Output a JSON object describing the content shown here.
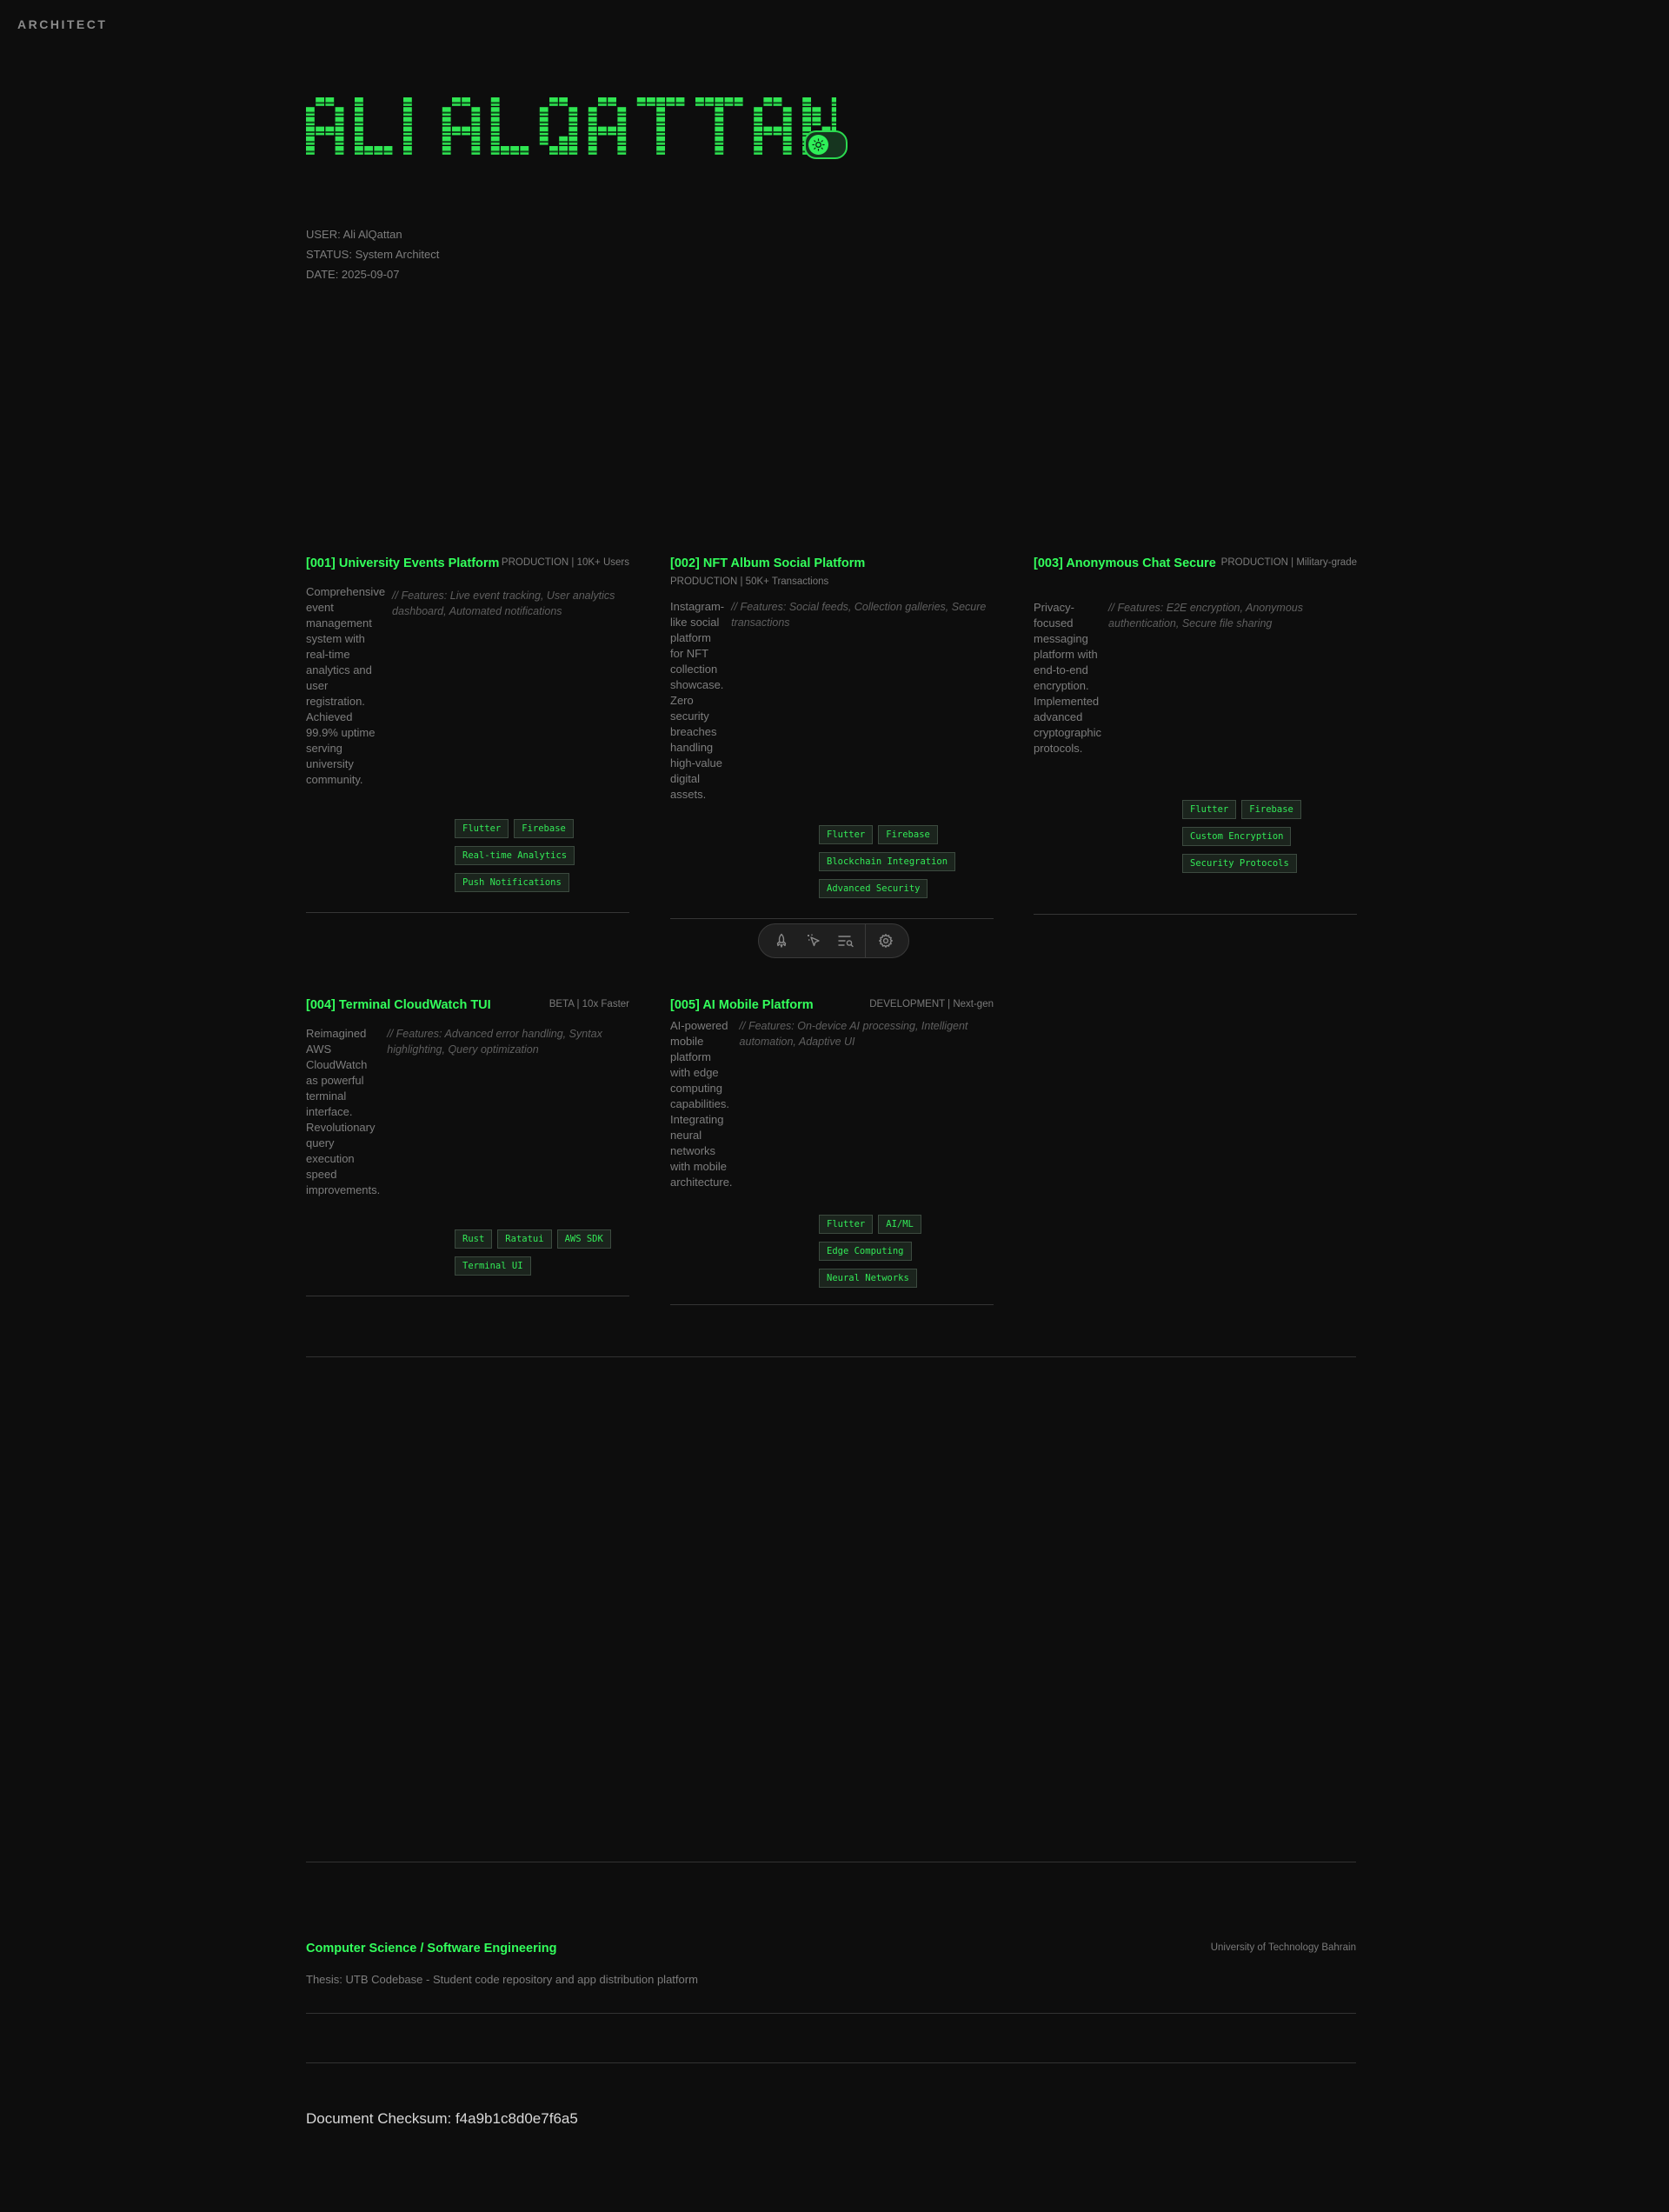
{
  "corner_label": "ARCHITECT",
  "hero": {
    "name": "ALI ALQATTAN"
  },
  "theme_toggle": {
    "icon": "sun-icon"
  },
  "meta": {
    "user": "USER: Ali AlQattan",
    "status": "STATUS: System Architect",
    "date": "DATE: 2025-09-07"
  },
  "projects": [
    {
      "title": "[001] University Events Platform",
      "status": "PRODUCTION | 10K+ Users",
      "desc_lines": [
        "Comprehensive",
        "event",
        "management",
        "system with",
        "real-time",
        "analytics and",
        "user",
        "registration.",
        "Achieved",
        "99.9% uptime",
        "serving",
        "university",
        "community."
      ],
      "features_lines": [
        "// Features: Live event tracking, User analytics",
        "dashboard, Automated notifications"
      ],
      "tags": [
        [
          "Flutter",
          "Firebase"
        ],
        [
          "Real-time Analytics"
        ],
        [
          "Push Notifications"
        ]
      ]
    },
    {
      "title": "[002] NFT Album Social Platform",
      "status": "PRODUCTION | 50K+ Transactions",
      "desc_lines": [
        "Instagram-",
        "like social",
        "platform",
        "for NFT",
        "collection",
        "showcase.",
        "Zero",
        "security",
        "breaches",
        "handling",
        "high-value",
        "digital",
        "assets."
      ],
      "features_lines": [
        "// Features: Social feeds, Collection galleries, Secure",
        "transactions"
      ],
      "tags": [
        [
          "Flutter",
          "Firebase"
        ],
        [
          "Blockchain Integration"
        ],
        [
          "Advanced Security"
        ]
      ]
    },
    {
      "title": "[003] Anonymous Chat Secure",
      "status": "PRODUCTION | Military-grade",
      "desc_lines": [
        "Privacy-",
        "focused",
        "messaging",
        "platform with",
        "end-to-end",
        "encryption.",
        "Implemented",
        "advanced",
        "cryptographic",
        "protocols."
      ],
      "features_lines": [
        "// Features: E2E encryption, Anonymous",
        "authentication, Secure file sharing"
      ],
      "tags": [
        [
          "Flutter",
          "Firebase"
        ],
        [
          "Custom Encryption"
        ],
        [
          "Security Protocols"
        ]
      ]
    },
    {
      "title": "[004] Terminal CloudWatch TUI",
      "status": "BETA | 10x Faster",
      "desc_lines": [
        "Reimagined",
        "AWS",
        "CloudWatch",
        "as powerful",
        "terminal",
        "interface.",
        "Revolutionary",
        "query",
        "execution",
        "speed",
        "improvements."
      ],
      "features_lines": [
        "// Features: Advanced error handling, Syntax",
        "highlighting, Query optimization"
      ],
      "tags": [
        [
          "Rust",
          "Ratatui",
          "AWS SDK"
        ],
        [
          "Terminal UI"
        ]
      ]
    },
    {
      "title": "[005] AI Mobile Platform",
      "status": "DEVELOPMENT | Next-gen",
      "desc_lines": [
        "AI-powered",
        "mobile",
        "platform",
        "with edge",
        "computing",
        "capabilities.",
        "Integrating",
        "neural",
        "networks",
        "with mobile",
        "architecture."
      ],
      "features_lines": [
        "// Features: On-device AI processing, Intelligent",
        "automation, Adaptive UI"
      ],
      "tags": [
        [
          "Flutter",
          "AI/ML"
        ],
        [
          "Edge Computing"
        ],
        [
          "Neural Networks"
        ]
      ]
    }
  ],
  "toolbar": {
    "items": [
      "rocket-icon",
      "cursor-sparkle-icon",
      "list-search-icon",
      "settings-gear-icon"
    ]
  },
  "education": {
    "title": "Computer Science / Software Engineering",
    "school": "University of Technology Bahrain",
    "thesis": "Thesis: UTB Codebase - Student code repository and app distribution platform"
  },
  "checksum": "Document Checksum: f4a9b1c8d0e7f6a5",
  "colors": {
    "accent": "#33ff5c",
    "background": "#0d0d0d",
    "muted_text": "#7d7d7d"
  }
}
